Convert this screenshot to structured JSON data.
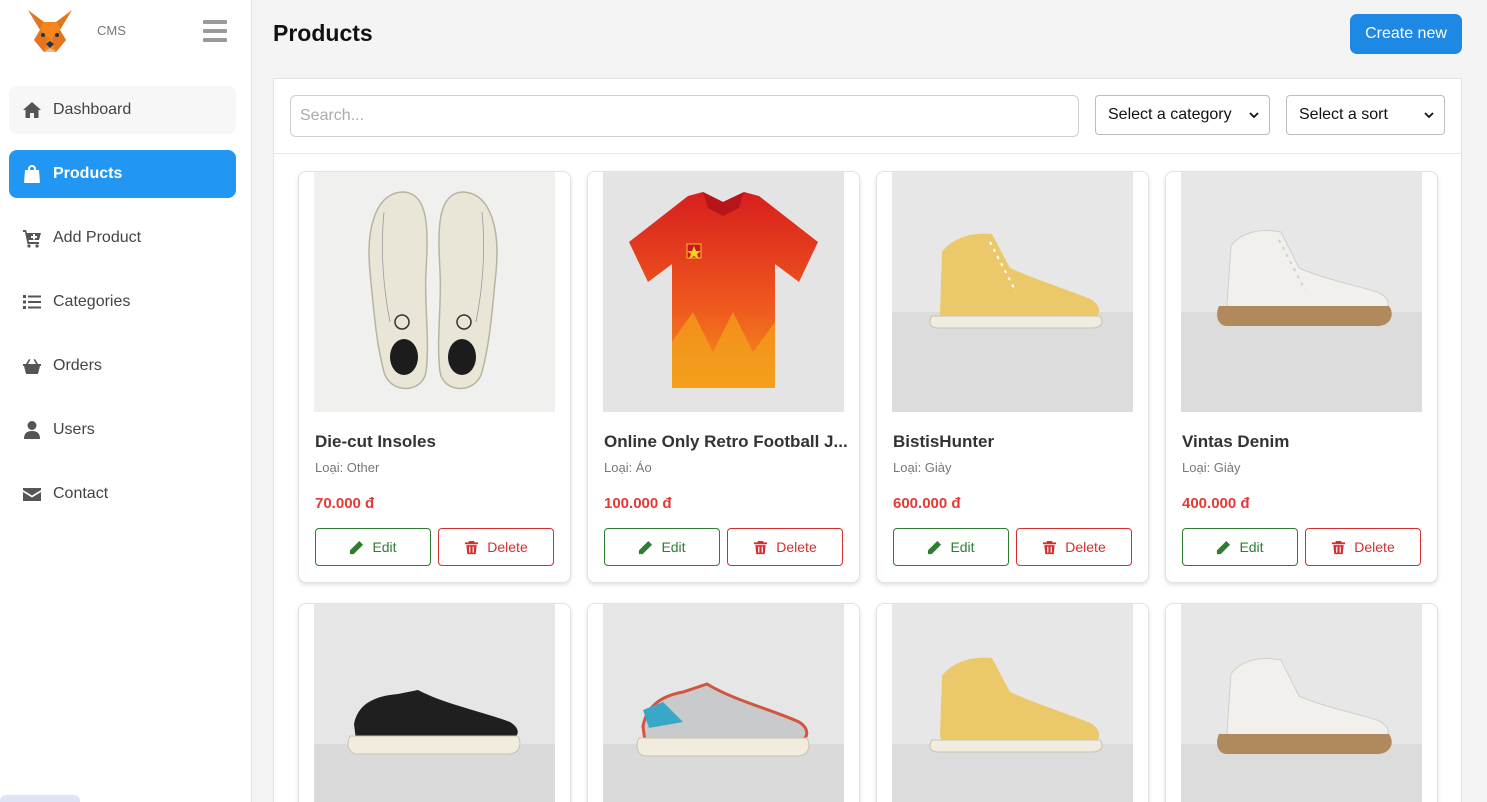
{
  "brand": {
    "name": "CMS",
    "logo_icon": "fox-logo-icon"
  },
  "sidebar": {
    "items": [
      {
        "label": "Dashboard",
        "icon": "home-icon"
      },
      {
        "label": "Products",
        "icon": "shopping-bag-icon",
        "active": true
      },
      {
        "label": "Add Product",
        "icon": "cart-plus-icon"
      },
      {
        "label": "Categories",
        "icon": "list-icon"
      },
      {
        "label": "Orders",
        "icon": "basket-icon"
      },
      {
        "label": "Users",
        "icon": "user-icon"
      },
      {
        "label": "Contact",
        "icon": "envelope-icon"
      }
    ]
  },
  "header": {
    "title": "Products",
    "create_label": "Create new"
  },
  "filters": {
    "search_placeholder": "Search...",
    "category_selected": "Select a category",
    "sort_selected": "Select a sort"
  },
  "colors": {
    "accent": "#2196f3",
    "edit": "#2e7d32",
    "delete": "#d32f2f",
    "price": "#e53935"
  },
  "products": [
    {
      "name": "Die-cut Insoles",
      "category": "Loại: Other",
      "price": "70.000 đ",
      "edit_label": "Edit",
      "delete_label": "Delete",
      "image": "insoles"
    },
    {
      "name": "Online Only Retro Football J...",
      "category": "Loại: Áo",
      "price": "100.000 đ",
      "edit_label": "Edit",
      "delete_label": "Delete",
      "image": "red-jersey"
    },
    {
      "name": "BistisHunter",
      "category": "Loại: Giày",
      "price": "600.000 đ",
      "edit_label": "Edit",
      "delete_label": "Delete",
      "image": "yellow-hightop"
    },
    {
      "name": "Vintas Denim",
      "category": "Loại: Giày",
      "price": "400.000 đ",
      "edit_label": "Edit",
      "delete_label": "Delete",
      "image": "white-hightop"
    },
    {
      "image": "black-lowtop"
    },
    {
      "image": "grey-blue-lowtop"
    },
    {
      "image": "yellow-hightop"
    },
    {
      "image": "white-hightop"
    }
  ]
}
